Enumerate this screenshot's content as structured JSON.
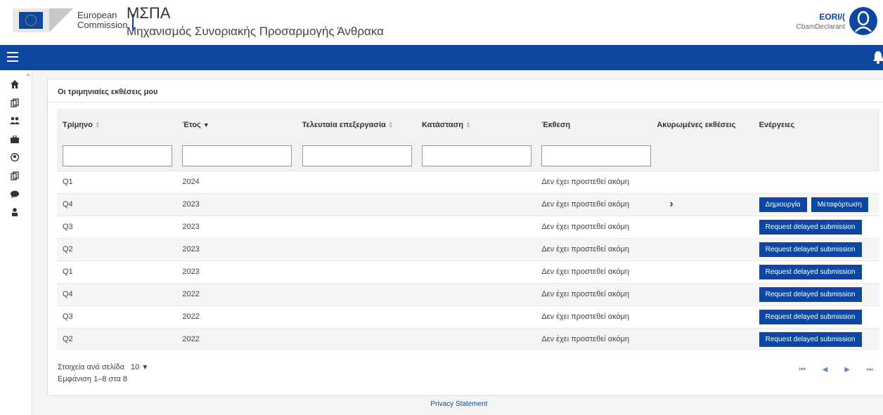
{
  "header": {
    "org_line1": "European",
    "org_line2": "Commission",
    "app_abbr": "ΜΣΠΑ",
    "app_full": "Μηχανισμός Συνοριακής Προσαρμογής Άνθρακα",
    "user_eori": "EORI/(",
    "user_role": "CbamDeclarant"
  },
  "card": {
    "title": "Οι τριμηνιαίες εκθέσεις μου"
  },
  "table": {
    "columns": [
      {
        "label": "Τρίμηνο",
        "sort": "⇕"
      },
      {
        "label": "Έτος",
        "sort": "▼"
      },
      {
        "label": "Τελευταία επεξεργασία",
        "sort": "⇕"
      },
      {
        "label": "Κατάσταση",
        "sort": "⇕"
      },
      {
        "label": "Έκθεση",
        "sort": ""
      },
      {
        "label": "Ακυρωμένες εκθέσεις",
        "sort": ""
      },
      {
        "label": "Ενέργειες",
        "sort": ""
      }
    ],
    "rows": [
      {
        "quarter": "Q1",
        "year": "2024",
        "last_edit": "",
        "status": "",
        "report": "Δεν έχει προστεθεί ακόμη",
        "cancelled": "",
        "actions": []
      },
      {
        "quarter": "Q4",
        "year": "2023",
        "last_edit": "",
        "status": "",
        "report": "Δεν έχει προστεθεί ακόμη",
        "cancelled": "›",
        "actions": [
          "Δημιουργία",
          "Μεταφόρτωση"
        ]
      },
      {
        "quarter": "Q3",
        "year": "2023",
        "last_edit": "",
        "status": "",
        "report": "Δεν έχει προστεθεί ακόμη",
        "cancelled": "",
        "actions": [
          "Request delayed submission"
        ]
      },
      {
        "quarter": "Q2",
        "year": "2023",
        "last_edit": "",
        "status": "",
        "report": "Δεν έχει προστεθεί ακόμη",
        "cancelled": "",
        "actions": [
          "Request delayed submission"
        ]
      },
      {
        "quarter": "Q1",
        "year": "2023",
        "last_edit": "",
        "status": "",
        "report": "Δεν έχει προστεθεί ακόμη",
        "cancelled": "",
        "actions": [
          "Request delayed submission"
        ]
      },
      {
        "quarter": "Q4",
        "year": "2022",
        "last_edit": "",
        "status": "",
        "report": "Δεν έχει προστεθεί ακόμη",
        "cancelled": "",
        "actions": [
          "Request delayed submission"
        ]
      },
      {
        "quarter": "Q3",
        "year": "2022",
        "last_edit": "",
        "status": "",
        "report": "Δεν έχει προστεθεί ακόμη",
        "cancelled": "",
        "actions": [
          "Request delayed submission"
        ]
      },
      {
        "quarter": "Q2",
        "year": "2022",
        "last_edit": "",
        "status": "",
        "report": "Δεν έχει προστεθεί ακόμη",
        "cancelled": "",
        "actions": [
          "Request delayed submission"
        ]
      }
    ]
  },
  "pagination": {
    "per_page_label": "Στοιχεία ανά σελίδα",
    "per_page_value": "10",
    "range_text": "Εμφάνιση 1–8 στα 8"
  },
  "footer": {
    "privacy": "Privacy Statement"
  },
  "colors": {
    "primary": "#0e47a1"
  }
}
